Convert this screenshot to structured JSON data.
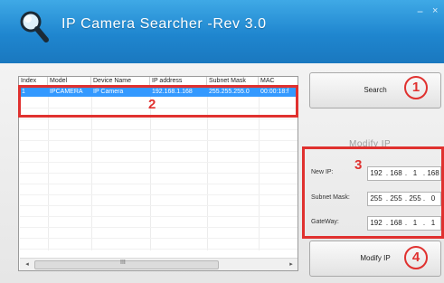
{
  "app": {
    "title": "IP Camera Searcher -Rev 3.0",
    "minimize_glyph": "−",
    "close_glyph": "×",
    "logo_icon": "search-icon"
  },
  "device_list": {
    "columns": [
      "Index",
      "Model",
      "Device Name",
      "IP address",
      "Subnet Mask",
      "MAC"
    ],
    "rows": [
      {
        "index": "1",
        "model": "IPCAMERA",
        "device_name": "IP Camera",
        "ip": "192.168.1.168",
        "mask": "255.255.255.0",
        "mac": "00:00:18:f"
      }
    ],
    "scroll_left": "◂",
    "scroll_right": "▸",
    "scroll_grip": "III"
  },
  "actions": {
    "search_label": "Search",
    "modify_section_label": "Modify IP",
    "modify_button_label": "Modify IP"
  },
  "fields": {
    "new_ip": {
      "label": "New IP:",
      "octets": [
        "192",
        "168",
        "1",
        "168"
      ]
    },
    "subnet_mask": {
      "label": "Subnet Mask:",
      "octets": [
        "255",
        "255",
        "255",
        "0"
      ]
    },
    "gateway": {
      "label": "GateWay:",
      "octets": [
        "192",
        "168",
        "1",
        "1"
      ]
    }
  },
  "annotations": {
    "marker_1": "1",
    "marker_2": "2",
    "marker_3": "3",
    "marker_4": "4",
    "color": "#e0312f"
  },
  "colors": {
    "titlebar": "#1f86cf",
    "selection": "#3399ff"
  }
}
